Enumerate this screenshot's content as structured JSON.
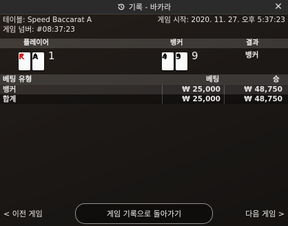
{
  "window": {
    "title": "기록 - 바카라",
    "history_icon": "history-clock-icon",
    "close_icon": "close-icon"
  },
  "info": {
    "table_label": "테이블: Speed Baccarat A",
    "game_start": "게임 시작: 2020. 11. 27. 오후 5:37:23",
    "game_number": "게임 넘버: #08:37:23"
  },
  "hands_header": {
    "player": "플레이어",
    "banker": "뱅커",
    "result": "결과"
  },
  "hands": {
    "player": {
      "cards": [
        {
          "rank": "K",
          "suit": "♦",
          "color": "#d21f1f"
        },
        {
          "rank": "A",
          "suit": "♠",
          "color": "#111111"
        }
      ],
      "score": "1"
    },
    "banker": {
      "cards": [
        {
          "rank": "4",
          "suit": "♠",
          "color": "#111111"
        },
        {
          "rank": "5",
          "suit": "♠",
          "color": "#111111"
        }
      ],
      "score": "9"
    },
    "result": "뱅커"
  },
  "bets": {
    "headers": {
      "type": "베팅 유형",
      "bet": "베팅",
      "win": "승"
    },
    "rows": [
      {
        "type": "뱅커",
        "bet": "₩ 25,000",
        "win": "₩ 48,750"
      },
      {
        "type": "합계",
        "bet": "₩ 25,000",
        "win": "₩ 48,750"
      }
    ]
  },
  "footer": {
    "prev": "< 이전 게임",
    "back": "게임 기록으로 돌아가기",
    "next": "다음 게임 >"
  }
}
